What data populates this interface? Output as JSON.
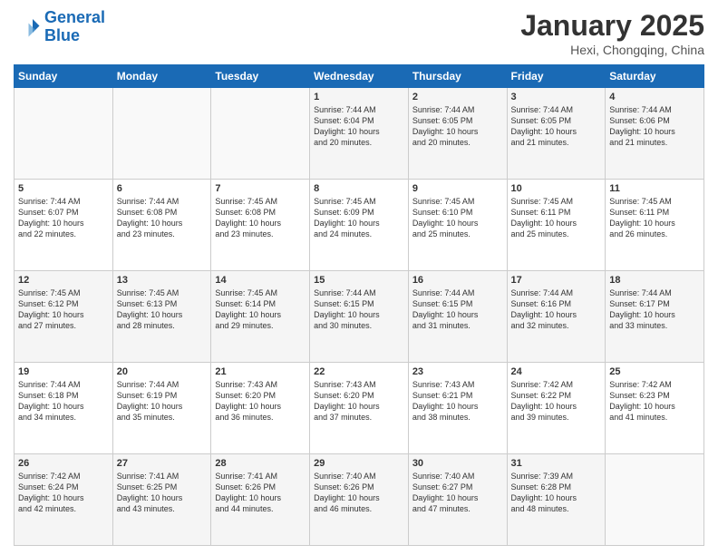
{
  "header": {
    "logo_line1": "General",
    "logo_line2": "Blue",
    "month_title": "January 2025",
    "location": "Hexi, Chongqing, China"
  },
  "weekdays": [
    "Sunday",
    "Monday",
    "Tuesday",
    "Wednesday",
    "Thursday",
    "Friday",
    "Saturday"
  ],
  "weeks": [
    [
      {
        "day": "",
        "info": ""
      },
      {
        "day": "",
        "info": ""
      },
      {
        "day": "",
        "info": ""
      },
      {
        "day": "1",
        "info": "Sunrise: 7:44 AM\nSunset: 6:04 PM\nDaylight: 10 hours\nand 20 minutes."
      },
      {
        "day": "2",
        "info": "Sunrise: 7:44 AM\nSunset: 6:05 PM\nDaylight: 10 hours\nand 20 minutes."
      },
      {
        "day": "3",
        "info": "Sunrise: 7:44 AM\nSunset: 6:05 PM\nDaylight: 10 hours\nand 21 minutes."
      },
      {
        "day": "4",
        "info": "Sunrise: 7:44 AM\nSunset: 6:06 PM\nDaylight: 10 hours\nand 21 minutes."
      }
    ],
    [
      {
        "day": "5",
        "info": "Sunrise: 7:44 AM\nSunset: 6:07 PM\nDaylight: 10 hours\nand 22 minutes."
      },
      {
        "day": "6",
        "info": "Sunrise: 7:44 AM\nSunset: 6:08 PM\nDaylight: 10 hours\nand 23 minutes."
      },
      {
        "day": "7",
        "info": "Sunrise: 7:45 AM\nSunset: 6:08 PM\nDaylight: 10 hours\nand 23 minutes."
      },
      {
        "day": "8",
        "info": "Sunrise: 7:45 AM\nSunset: 6:09 PM\nDaylight: 10 hours\nand 24 minutes."
      },
      {
        "day": "9",
        "info": "Sunrise: 7:45 AM\nSunset: 6:10 PM\nDaylight: 10 hours\nand 25 minutes."
      },
      {
        "day": "10",
        "info": "Sunrise: 7:45 AM\nSunset: 6:11 PM\nDaylight: 10 hours\nand 25 minutes."
      },
      {
        "day": "11",
        "info": "Sunrise: 7:45 AM\nSunset: 6:11 PM\nDaylight: 10 hours\nand 26 minutes."
      }
    ],
    [
      {
        "day": "12",
        "info": "Sunrise: 7:45 AM\nSunset: 6:12 PM\nDaylight: 10 hours\nand 27 minutes."
      },
      {
        "day": "13",
        "info": "Sunrise: 7:45 AM\nSunset: 6:13 PM\nDaylight: 10 hours\nand 28 minutes."
      },
      {
        "day": "14",
        "info": "Sunrise: 7:45 AM\nSunset: 6:14 PM\nDaylight: 10 hours\nand 29 minutes."
      },
      {
        "day": "15",
        "info": "Sunrise: 7:44 AM\nSunset: 6:15 PM\nDaylight: 10 hours\nand 30 minutes."
      },
      {
        "day": "16",
        "info": "Sunrise: 7:44 AM\nSunset: 6:15 PM\nDaylight: 10 hours\nand 31 minutes."
      },
      {
        "day": "17",
        "info": "Sunrise: 7:44 AM\nSunset: 6:16 PM\nDaylight: 10 hours\nand 32 minutes."
      },
      {
        "day": "18",
        "info": "Sunrise: 7:44 AM\nSunset: 6:17 PM\nDaylight: 10 hours\nand 33 minutes."
      }
    ],
    [
      {
        "day": "19",
        "info": "Sunrise: 7:44 AM\nSunset: 6:18 PM\nDaylight: 10 hours\nand 34 minutes."
      },
      {
        "day": "20",
        "info": "Sunrise: 7:44 AM\nSunset: 6:19 PM\nDaylight: 10 hours\nand 35 minutes."
      },
      {
        "day": "21",
        "info": "Sunrise: 7:43 AM\nSunset: 6:20 PM\nDaylight: 10 hours\nand 36 minutes."
      },
      {
        "day": "22",
        "info": "Sunrise: 7:43 AM\nSunset: 6:20 PM\nDaylight: 10 hours\nand 37 minutes."
      },
      {
        "day": "23",
        "info": "Sunrise: 7:43 AM\nSunset: 6:21 PM\nDaylight: 10 hours\nand 38 minutes."
      },
      {
        "day": "24",
        "info": "Sunrise: 7:42 AM\nSunset: 6:22 PM\nDaylight: 10 hours\nand 39 minutes."
      },
      {
        "day": "25",
        "info": "Sunrise: 7:42 AM\nSunset: 6:23 PM\nDaylight: 10 hours\nand 41 minutes."
      }
    ],
    [
      {
        "day": "26",
        "info": "Sunrise: 7:42 AM\nSunset: 6:24 PM\nDaylight: 10 hours\nand 42 minutes."
      },
      {
        "day": "27",
        "info": "Sunrise: 7:41 AM\nSunset: 6:25 PM\nDaylight: 10 hours\nand 43 minutes."
      },
      {
        "day": "28",
        "info": "Sunrise: 7:41 AM\nSunset: 6:26 PM\nDaylight: 10 hours\nand 44 minutes."
      },
      {
        "day": "29",
        "info": "Sunrise: 7:40 AM\nSunset: 6:26 PM\nDaylight: 10 hours\nand 46 minutes."
      },
      {
        "day": "30",
        "info": "Sunrise: 7:40 AM\nSunset: 6:27 PM\nDaylight: 10 hours\nand 47 minutes."
      },
      {
        "day": "31",
        "info": "Sunrise: 7:39 AM\nSunset: 6:28 PM\nDaylight: 10 hours\nand 48 minutes."
      },
      {
        "day": "",
        "info": ""
      }
    ]
  ]
}
